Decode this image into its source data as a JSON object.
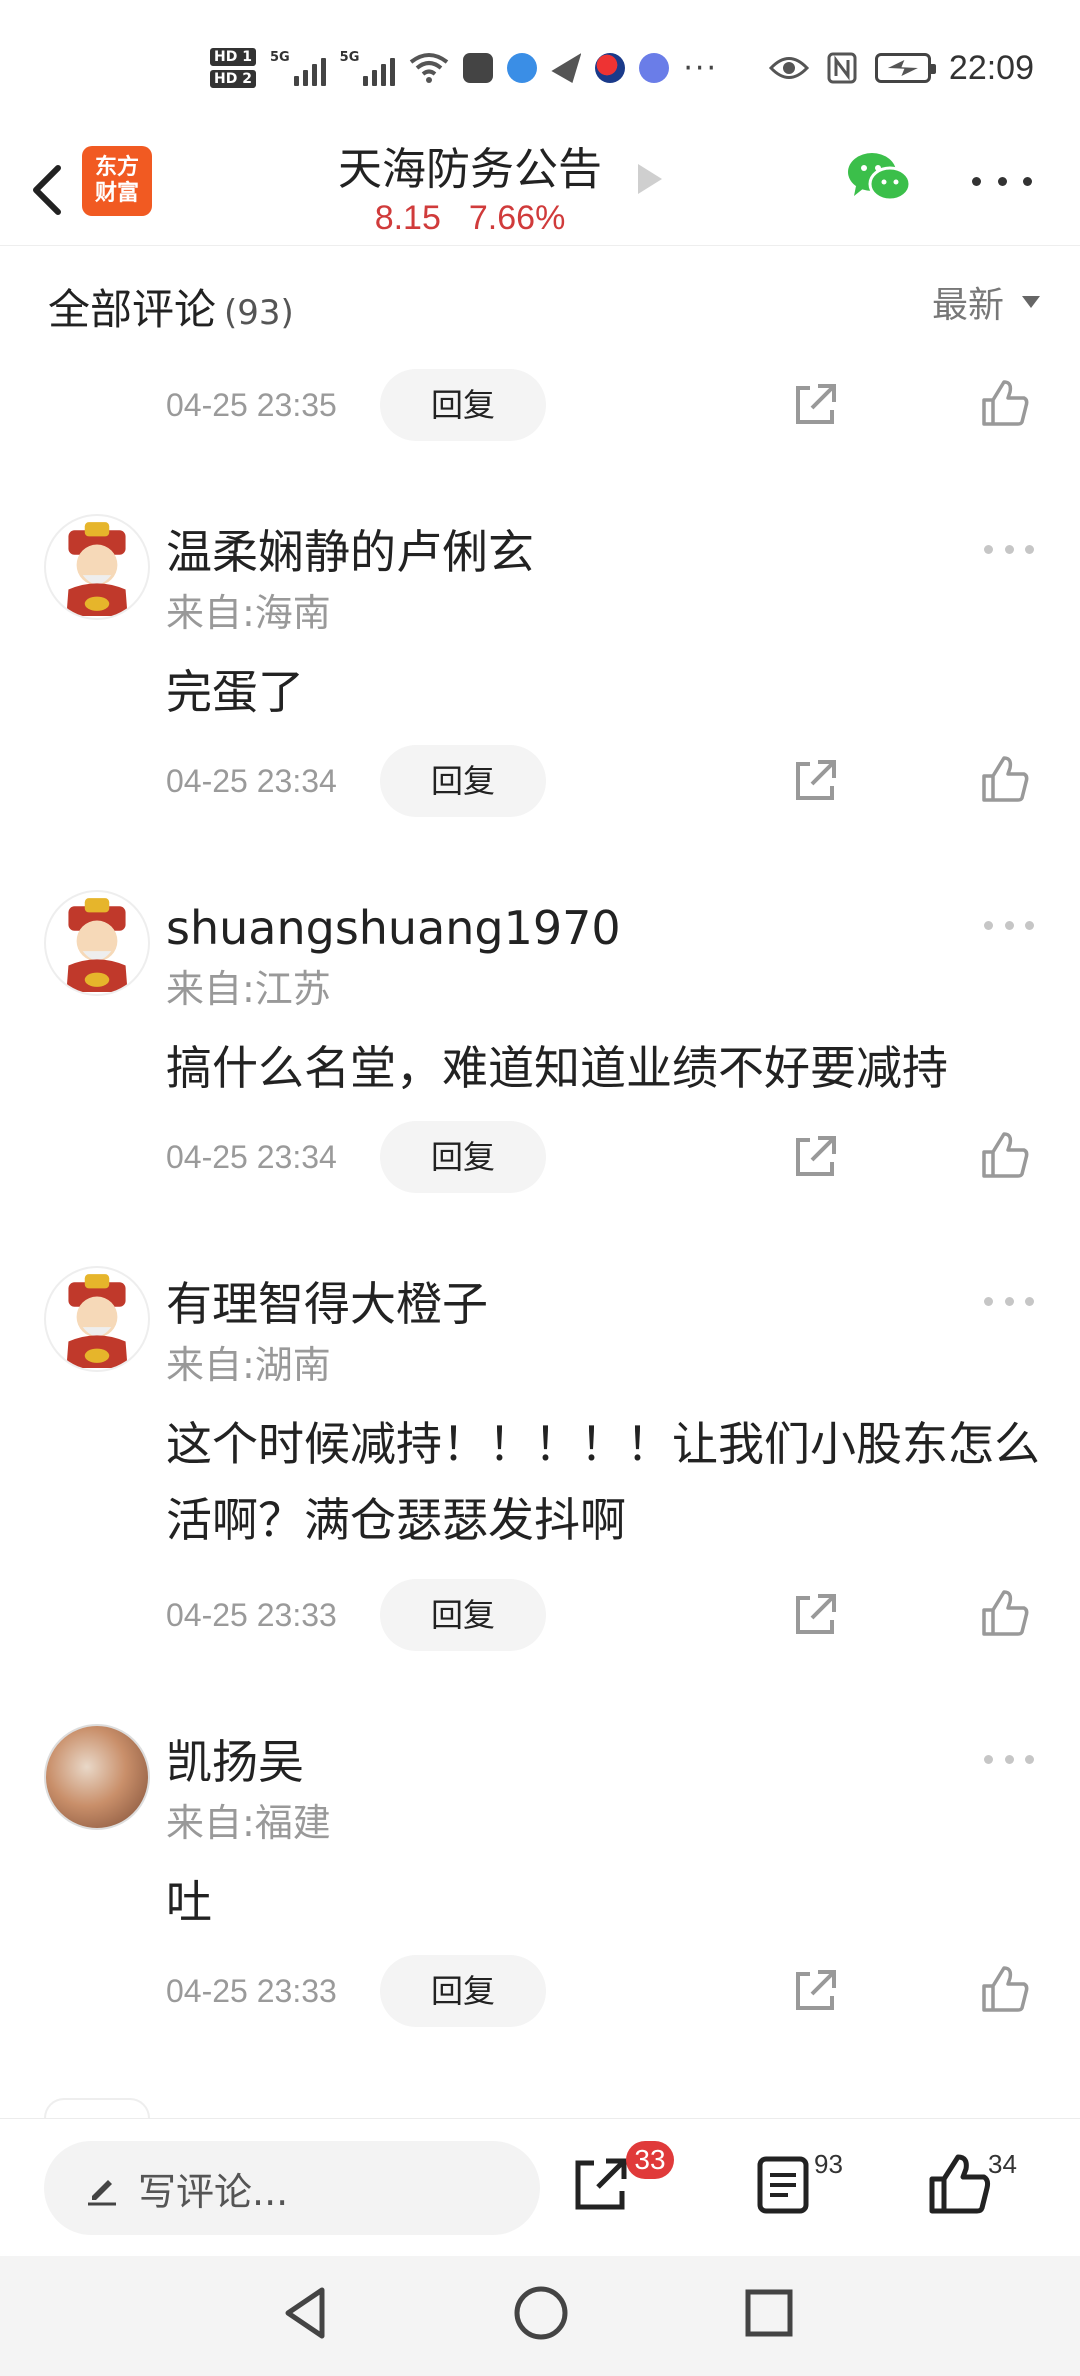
{
  "status_bar": {
    "time": "22:09",
    "hd1": "HD 1",
    "hd2": "HD 2",
    "net1": "5G",
    "net2": "5G",
    "overflow": "···"
  },
  "header": {
    "logo_top": "东方",
    "logo_bottom": "财富",
    "title": "天海防务公告",
    "price": "8.15",
    "change": "7.66%"
  },
  "section": {
    "title": "全部评论",
    "count": "(93)",
    "sort_label": "最新"
  },
  "reply_label": "回复",
  "comments": [
    {
      "time": "04-25 23:35"
    },
    {
      "name": "温柔娴静的卢俐玄",
      "from": "来自:海南",
      "text": "完蛋了",
      "time": "04-25 23:34"
    },
    {
      "name": "shuangshuang1970",
      "from": "来自:江苏",
      "text": "搞什么名堂，难道知道业绩不好要减持",
      "time": "04-25 23:34"
    },
    {
      "name": "有理智得大橙子",
      "from": "来自:湖南",
      "text": "这个时候减持！！！！！让我们小股东怎么活啊？满仓瑟瑟发抖啊",
      "time": "04-25 23:33"
    },
    {
      "name": "凯扬吴",
      "from": "来自:福建",
      "text": "吐",
      "time": "04-25 23:33"
    }
  ],
  "bottom_bar": {
    "comment_placeholder": "写评论...",
    "share_badge": "33",
    "comment_count": "93",
    "like_count": "34"
  },
  "colors": {
    "accent_red": "#d03b3b",
    "logo_orange": "#f15a22",
    "badge_red": "#e03a3a",
    "wechat_green": "#3bbf4a"
  }
}
